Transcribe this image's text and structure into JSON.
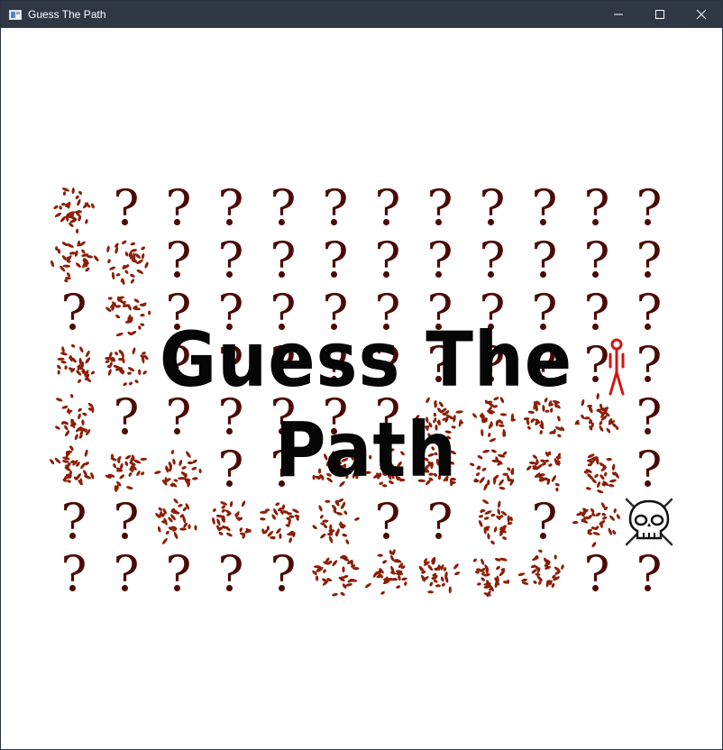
{
  "window": {
    "title": "Guess The Path",
    "controls": [
      "minimize",
      "maximize",
      "close"
    ]
  },
  "game": {
    "banner_text": "Guess The Path",
    "grid_rows": 8,
    "grid_cols": 12,
    "legend": {
      "P": "path-tile",
      "?": "unknown-tile",
      "S": "skull-tile"
    },
    "grid": [
      "P???????????",
      "PP??????????",
      "?P??????????",
      "PP??????????",
      "P??????PPPP?",
      "PPP??PPPPPP?",
      "??PPPP??P?PS",
      "?????PPPPP??"
    ],
    "icons": {
      "path": "path-pebbles-icon",
      "unknown": "question-mark-icon",
      "skull": "skull-crossbones-icon",
      "figure": "stick-figure-icon"
    },
    "colors": {
      "path": "#8b1e06",
      "question": "#4b0a06",
      "figure": "#d41414",
      "titlebar": "#2f3744"
    }
  }
}
